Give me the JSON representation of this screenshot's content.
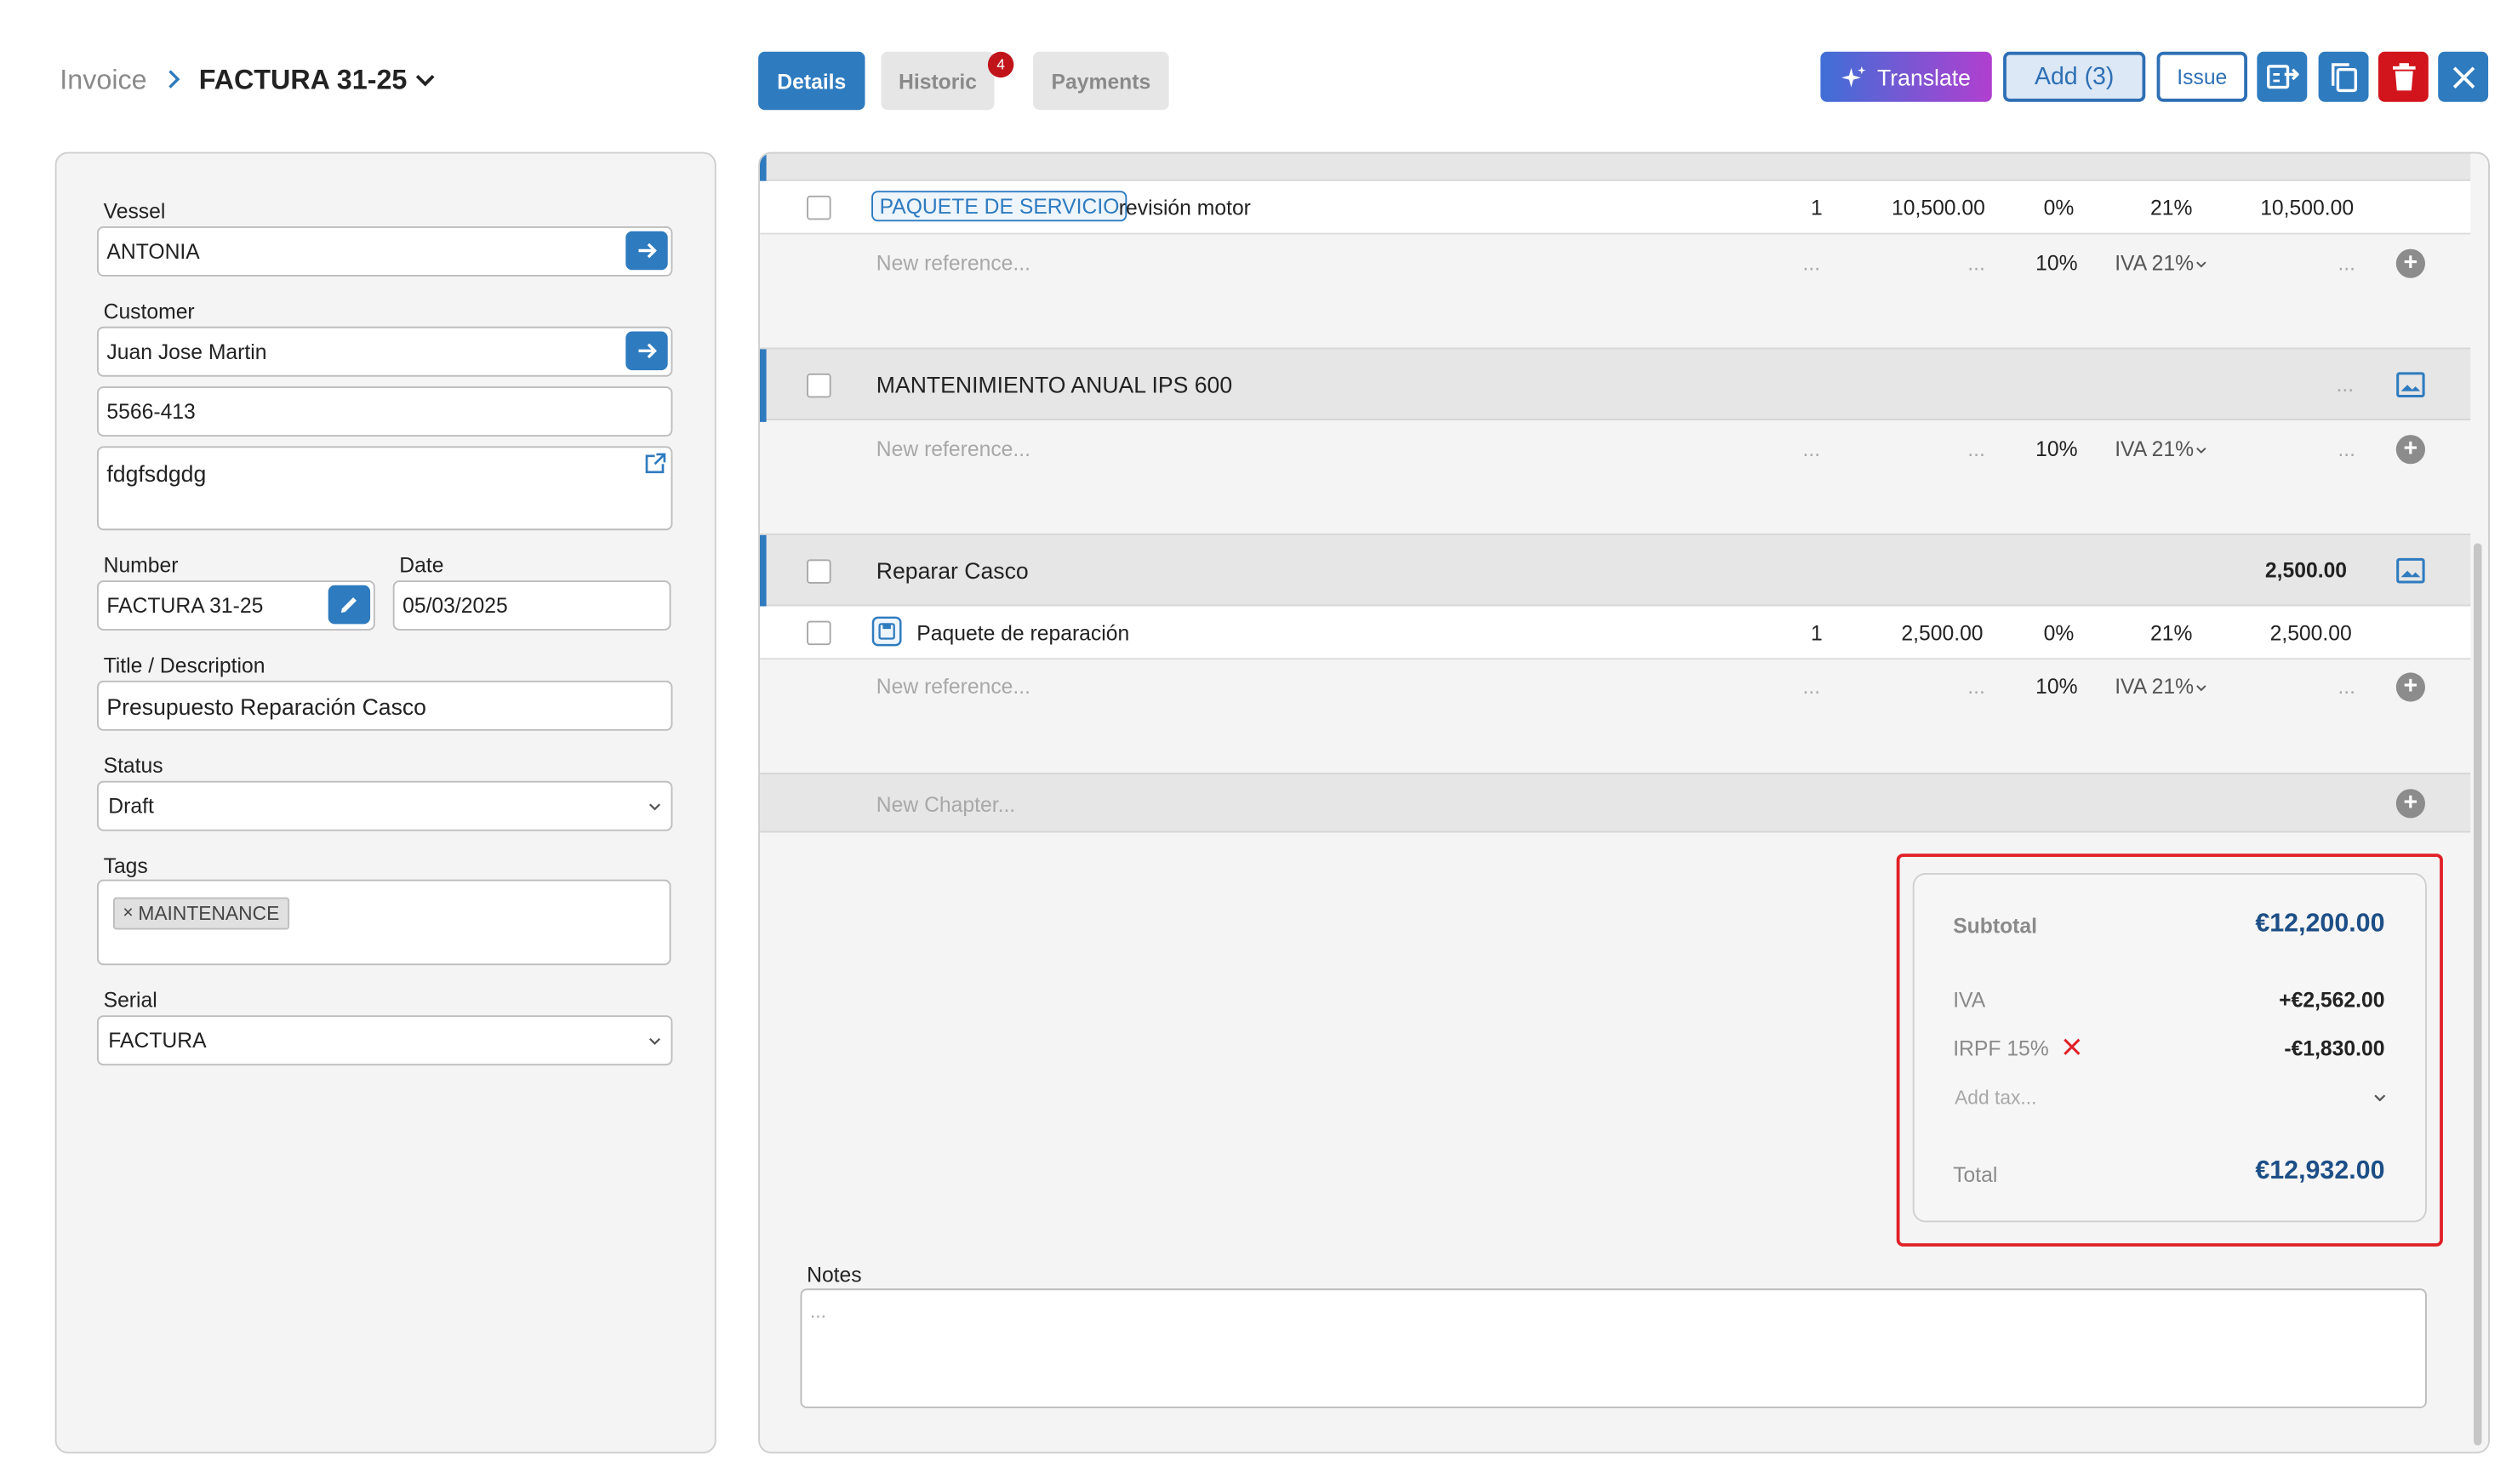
{
  "header": {
    "breadcrumb_root": "Invoice",
    "title": "FACTURA 31-25",
    "tabs": [
      {
        "label": "Details"
      },
      {
        "label": "Historic",
        "badge": "4"
      },
      {
        "label": "Payments"
      }
    ],
    "toolbar": {
      "translate_label": "Translate",
      "add_label": "Add (3)",
      "issue_label": "Issue"
    }
  },
  "form": {
    "vessel_label": "Vessel",
    "vessel_value": "ANTONIA",
    "customer_label": "Customer",
    "customer_value": "Juan Jose Martin",
    "customer_code": "5566-413",
    "customer_notes": "fdgfsdgdg",
    "number_label": "Number",
    "number_value": "FACTURA 31-25",
    "date_label": "Date",
    "date_value": "05/03/2025",
    "title_label": "Title / Description",
    "title_value": "Presupuesto Reparación Casco",
    "status_label": "Status",
    "status_value": "Draft",
    "tags_label": "Tags",
    "tags": [
      "MAINTENANCE"
    ],
    "tag_remove": "×",
    "serial_label": "Serial",
    "serial_value": "FACTURA"
  },
  "lines": {
    "item1": {
      "pill": "PAQUETE DE SERVICIO",
      "desc": "revisión motor",
      "qty": "1",
      "price": "10,500.00",
      "discount": "0%",
      "tax": "21%",
      "total": "10,500.00"
    },
    "newref": {
      "placeholder": "New reference...",
      "dots": "...",
      "discount": "10%",
      "tax": "IVA 21%"
    },
    "chapter2": {
      "title": "MANTENIMIENTO ANUAL IPS 600",
      "total": "..."
    },
    "chapter3": {
      "title": "Reparar Casco",
      "total": "2,500.00"
    },
    "item3": {
      "desc": "Paquete de reparación",
      "qty": "1",
      "price": "2,500.00",
      "discount": "0%",
      "tax": "21%",
      "total": "2,500.00"
    },
    "new_chapter": "New Chapter..."
  },
  "totals": {
    "subtotal_label": "Subtotal",
    "subtotal_value": "€12,200.00",
    "iva_label": "IVA",
    "iva_value": "+€2,562.00",
    "irpf_label": "IRPF 15%",
    "irpf_value": "-€1,830.00",
    "add_tax_placeholder": "Add tax...",
    "total_label": "Total",
    "total_value": "€12,932.00"
  },
  "notes": {
    "label": "Notes",
    "placeholder": "..."
  },
  "colors": {
    "primary": "#2e7bbf",
    "danger": "#d2141c",
    "highlight": "#e02027"
  }
}
